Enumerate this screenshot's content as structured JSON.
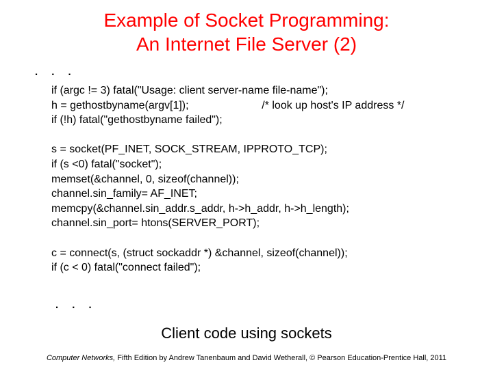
{
  "title_line1": "Example of Socket Programming:",
  "title_line2": "An Internet File Server (2)",
  "ellipsis_top": ". . .",
  "code": {
    "l1": "if (argc != 3) fatal(\"Usage: client server-name file-name\");",
    "l2": "h = gethostbyname(argv[1]);                        /* look up host's IP address */",
    "l3": "if (!h) fatal(\"gethostbyname failed\");",
    "l4": "",
    "l5": "s = socket(PF_INET, SOCK_STREAM, IPPROTO_TCP);",
    "l6": "if (s <0) fatal(\"socket\");",
    "l7": "memset(&channel, 0, sizeof(channel));",
    "l8": "channel.sin_family= AF_INET;",
    "l9": "memcpy(&channel.sin_addr.s_addr, h->h_addr, h->h_length);",
    "l10": "channel.sin_port= htons(SERVER_PORT);",
    "l11": "",
    "l12": "c = connect(s, (struct sockaddr *) &channel, sizeof(channel));",
    "l13": "if (c < 0) fatal(\"connect failed\");"
  },
  "ellipsis_bottom": ". . .",
  "caption": "Client code using sockets",
  "footer_book": "Computer Networks,",
  "footer_rest": " Fifth Edition by Andrew Tanenbaum and David Wetherall, © Pearson Education-Prentice Hall, 2011"
}
